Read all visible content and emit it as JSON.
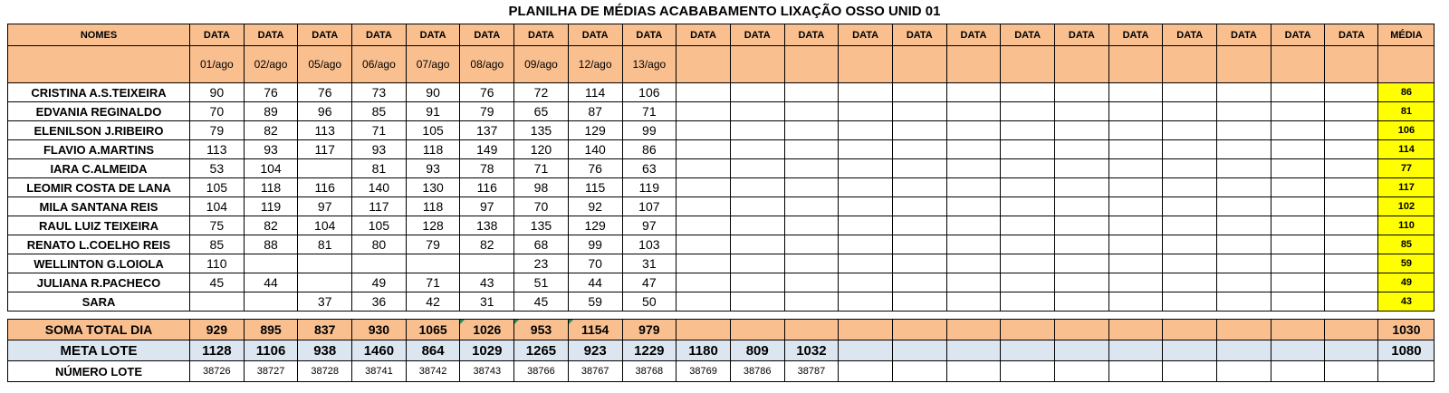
{
  "title": "PLANILHA DE MÉDIAS ACABABAMENTO LIXAÇÃO OSSO UNID 01",
  "header": {
    "names_label": "NOMES",
    "date_label": "DATA",
    "avg_label": "MÉDIA",
    "dates": [
      "01/ago",
      "02/ago",
      "05/ago",
      "06/ago",
      "07/ago",
      "08/ago",
      "09/ago",
      "12/ago",
      "13/ago",
      "",
      "",
      "",
      "",
      "",
      "",
      "",
      "",
      "",
      "",
      "",
      "",
      ""
    ]
  },
  "employees": [
    {
      "name": "CRISTINA A.S.TEIXEIRA",
      "values": [
        "90",
        "76",
        "76",
        "73",
        "90",
        "76",
        "72",
        "114",
        "106"
      ],
      "avg": "86"
    },
    {
      "name": "EDVANIA REGINALDO",
      "values": [
        "70",
        "89",
        "96",
        "85",
        "91",
        "79",
        "65",
        "87",
        "71"
      ],
      "avg": "81"
    },
    {
      "name": "ELENILSON J.RIBEIRO",
      "values": [
        "79",
        "82",
        "113",
        "71",
        "105",
        "137",
        "135",
        "129",
        "99"
      ],
      "avg": "106"
    },
    {
      "name": "FLAVIO A.MARTINS",
      "values": [
        "113",
        "93",
        "117",
        "93",
        "118",
        "149",
        "120",
        "140",
        "86"
      ],
      "avg": "114"
    },
    {
      "name": "IARA C.ALMEIDA",
      "values": [
        "53",
        "104",
        "",
        "81",
        "93",
        "78",
        "71",
        "76",
        "63"
      ],
      "avg": "77"
    },
    {
      "name": "LEOMIR COSTA DE LANA",
      "values": [
        "105",
        "118",
        "116",
        "140",
        "130",
        "116",
        "98",
        "115",
        "119"
      ],
      "avg": "117"
    },
    {
      "name": "MILA SANTANA REIS",
      "values": [
        "104",
        "119",
        "97",
        "117",
        "118",
        "97",
        "70",
        "92",
        "107"
      ],
      "avg": "102"
    },
    {
      "name": "RAUL LUIZ TEIXEIRA",
      "values": [
        "75",
        "82",
        "104",
        "105",
        "128",
        "138",
        "135",
        "129",
        "97"
      ],
      "avg": "110"
    },
    {
      "name": "RENATO L.COELHO REIS",
      "values": [
        "85",
        "88",
        "81",
        "80",
        "79",
        "82",
        "68",
        "99",
        "103"
      ],
      "avg": "85"
    },
    {
      "name": "WELLINTON G.LOIOLA",
      "values": [
        "110",
        "",
        "",
        "",
        "",
        "",
        "23",
        "70",
        "31"
      ],
      "avg": "59"
    },
    {
      "name": "JULIANA R.PACHECO",
      "values": [
        "45",
        "44",
        "",
        "49",
        "71",
        "43",
        "51",
        "44",
        "47"
      ],
      "avg": "49"
    },
    {
      "name": "SARA",
      "values": [
        "",
        "",
        "37",
        "36",
        "42",
        "31",
        "45",
        "59",
        "50"
      ],
      "avg": "43"
    }
  ],
  "totals": {
    "label": "SOMA TOTAL DIA",
    "values": [
      "929",
      "895",
      "837",
      "930",
      "1065",
      "1026",
      "953",
      "1154",
      "979"
    ],
    "avg": "1030"
  },
  "meta": {
    "label": "META LOTE",
    "values": [
      "1128",
      "1106",
      "938",
      "1460",
      "864",
      "1029",
      "1265",
      "923",
      "1229",
      "1180",
      "809",
      "1032"
    ],
    "avg": "1080"
  },
  "lote": {
    "label": "NÚMERO LOTE",
    "values": [
      "38726",
      "38727",
      "38728",
      "38741",
      "38742",
      "38743",
      "38766",
      "38767",
      "38768",
      "38769",
      "38786",
      "38787"
    ]
  },
  "colors": {
    "header_bg": "#f9bf8f",
    "avg_bg": "#ffff00",
    "meta_bg": "#dce6f1"
  }
}
